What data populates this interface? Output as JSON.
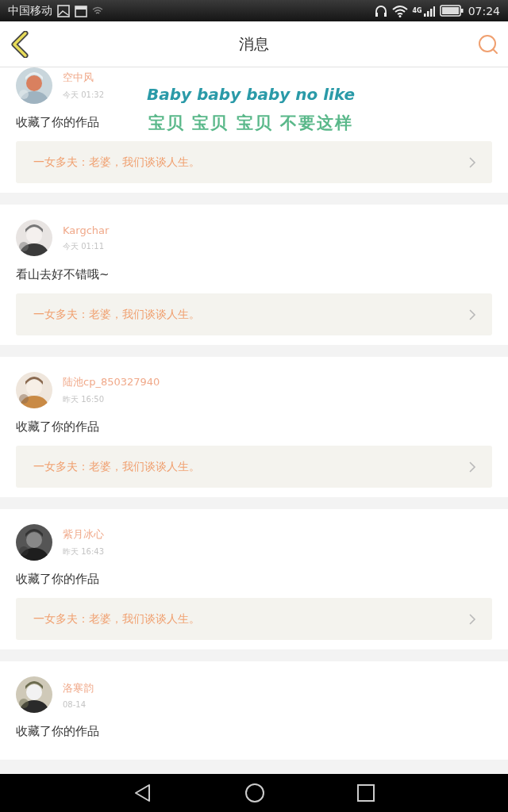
{
  "status_bar": {
    "carrier": "中国移动",
    "network": "4G",
    "time": "07:24"
  },
  "header": {
    "title": "消息"
  },
  "overlay": {
    "line_1": "Baby baby baby no like",
    "line_2": "宝贝 宝贝 宝贝 不要这样"
  },
  "messages": [
    {
      "user": "空中风",
      "time": "今天 01:32",
      "text": "收藏了你的作品",
      "quote": "一女多夫：老婆，我们谈谈人生。"
    },
    {
      "user": "Kargchar",
      "time": "今天 01:11",
      "text": "看山去好不错哦~",
      "quote": "一女多夫：老婆，我们谈谈人生。"
    },
    {
      "user": "陆池cp_850327940",
      "time": "昨天 16:50",
      "text": "收藏了你的作品",
      "quote": "一女多夫：老婆，我们谈谈人生。"
    },
    {
      "user": "紫月冰心",
      "time": "昨天 16:43",
      "text": "收藏了你的作品",
      "quote": "一女多夫：老婆，我们谈谈人生。"
    },
    {
      "user": "洛寒韵",
      "time": "08-14",
      "text": "收藏了你的作品"
    }
  ]
}
